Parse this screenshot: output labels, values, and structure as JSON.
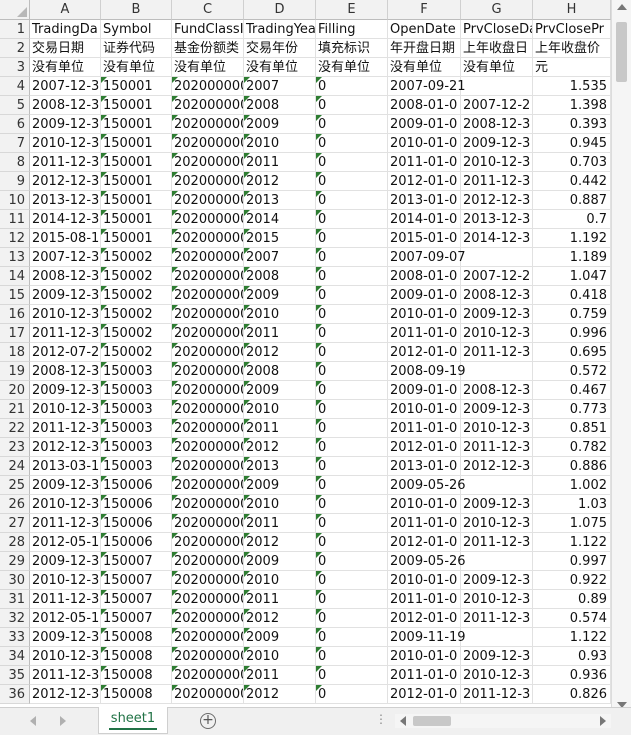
{
  "sheet_tab": "sheet1",
  "columns": [
    "A",
    "B",
    "C",
    "D",
    "E",
    "F",
    "G",
    "H"
  ],
  "row_numbers": [
    "1",
    "2",
    "3",
    "4",
    "5",
    "6",
    "7",
    "8",
    "9",
    "10",
    "11",
    "12",
    "13",
    "14",
    "15",
    "16",
    "17",
    "18",
    "19",
    "20",
    "21",
    "22",
    "23",
    "24",
    "25",
    "26",
    "27",
    "28",
    "29",
    "30",
    "31",
    "32",
    "33",
    "34",
    "35",
    "36"
  ],
  "rows": [
    [
      "TradingDa",
      "Symbol",
      "FundClassI",
      "TradingYea",
      "Filling",
      "OpenDate",
      "PrvCloseDa",
      "PrvClosePr"
    ],
    [
      "交易日期",
      "证券代码",
      "基金份额类",
      "交易年份",
      "填充标识",
      "年开盘日期",
      "上年收盘日",
      "上年收盘价"
    ],
    [
      "没有单位",
      "没有单位",
      "没有单位",
      "没有单位",
      "没有单位",
      "没有单位",
      "没有单位",
      "元"
    ],
    [
      "2007-12-3",
      "150001",
      "202000000",
      "2007",
      "0",
      "2007-09-21",
      "",
      "1.535"
    ],
    [
      "2008-12-3",
      "150001",
      "202000000",
      "2008",
      "0",
      "2008-01-0",
      "2007-12-2",
      "1.398"
    ],
    [
      "2009-12-3",
      "150001",
      "202000000",
      "2009",
      "0",
      "2009-01-0",
      "2008-12-3",
      "0.393"
    ],
    [
      "2010-12-3",
      "150001",
      "202000000",
      "2010",
      "0",
      "2010-01-0",
      "2009-12-3",
      "0.945"
    ],
    [
      "2011-12-3",
      "150001",
      "202000000",
      "2011",
      "0",
      "2011-01-0",
      "2010-12-3",
      "0.703"
    ],
    [
      "2012-12-3",
      "150001",
      "202000000",
      "2012",
      "0",
      "2012-01-0",
      "2011-12-3",
      "0.442"
    ],
    [
      "2013-12-3",
      "150001",
      "202000000",
      "2013",
      "0",
      "2013-01-0",
      "2012-12-3",
      "0.887"
    ],
    [
      "2014-12-3",
      "150001",
      "202000000",
      "2014",
      "0",
      "2014-01-0",
      "2013-12-3",
      "0.7"
    ],
    [
      "2015-08-1",
      "150001",
      "202000000",
      "2015",
      "0",
      "2015-01-0",
      "2014-12-3",
      "1.192"
    ],
    [
      "2007-12-3",
      "150002",
      "202000000",
      "2007",
      "0",
      "2007-09-07",
      "",
      "1.189"
    ],
    [
      "2008-12-3",
      "150002",
      "202000000",
      "2008",
      "0",
      "2008-01-0",
      "2007-12-2",
      "1.047"
    ],
    [
      "2009-12-3",
      "150002",
      "202000000",
      "2009",
      "0",
      "2009-01-0",
      "2008-12-3",
      "0.418"
    ],
    [
      "2010-12-3",
      "150002",
      "202000000",
      "2010",
      "0",
      "2010-01-0",
      "2009-12-3",
      "0.759"
    ],
    [
      "2011-12-3",
      "150002",
      "202000000",
      "2011",
      "0",
      "2011-01-0",
      "2010-12-3",
      "0.996"
    ],
    [
      "2012-07-2",
      "150002",
      "202000000",
      "2012",
      "0",
      "2012-01-0",
      "2011-12-3",
      "0.695"
    ],
    [
      "2008-12-3",
      "150003",
      "202000000",
      "2008",
      "0",
      "2008-09-19",
      "",
      "0.572"
    ],
    [
      "2009-12-3",
      "150003",
      "202000000",
      "2009",
      "0",
      "2009-01-0",
      "2008-12-3",
      "0.467"
    ],
    [
      "2010-12-3",
      "150003",
      "202000000",
      "2010",
      "0",
      "2010-01-0",
      "2009-12-3",
      "0.773"
    ],
    [
      "2011-12-3",
      "150003",
      "202000000",
      "2011",
      "0",
      "2011-01-0",
      "2010-12-3",
      "0.851"
    ],
    [
      "2012-12-3",
      "150003",
      "202000000",
      "2012",
      "0",
      "2012-01-0",
      "2011-12-3",
      "0.782"
    ],
    [
      "2013-03-1",
      "150003",
      "202000000",
      "2013",
      "0",
      "2013-01-0",
      "2012-12-3",
      "0.886"
    ],
    [
      "2009-12-3",
      "150006",
      "202000000",
      "2009",
      "0",
      "2009-05-26",
      "",
      "1.002"
    ],
    [
      "2010-12-3",
      "150006",
      "202000000",
      "2010",
      "0",
      "2010-01-0",
      "2009-12-3",
      "1.03"
    ],
    [
      "2011-12-3",
      "150006",
      "202000000",
      "2011",
      "0",
      "2011-01-0",
      "2010-12-3",
      "1.075"
    ],
    [
      "2012-05-1",
      "150006",
      "202000000",
      "2012",
      "0",
      "2012-01-0",
      "2011-12-3",
      "1.122"
    ],
    [
      "2009-12-3",
      "150007",
      "202000000",
      "2009",
      "0",
      "2009-05-26",
      "",
      "0.997"
    ],
    [
      "2010-12-3",
      "150007",
      "202000000",
      "2010",
      "0",
      "2010-01-0",
      "2009-12-3",
      "0.922"
    ],
    [
      "2011-12-3",
      "150007",
      "202000000",
      "2011",
      "0",
      "2011-01-0",
      "2010-12-3",
      "0.89"
    ],
    [
      "2012-05-1",
      "150007",
      "202000000",
      "2012",
      "0",
      "2012-01-0",
      "2011-12-3",
      "0.574"
    ],
    [
      "2009-12-3",
      "150008",
      "202000000",
      "2009",
      "0",
      "2009-11-19",
      "",
      "1.122"
    ],
    [
      "2010-12-3",
      "150008",
      "202000000",
      "2010",
      "0",
      "2010-01-0",
      "2009-12-3",
      "0.93"
    ],
    [
      "2011-12-3",
      "150008",
      "202000000",
      "2011",
      "0",
      "2011-01-0",
      "2010-12-3",
      "0.936"
    ],
    [
      "2012-12-3",
      "150008",
      "202000000",
      "2012",
      "0",
      "2012-01-0",
      "2011-12-3",
      "0.826"
    ]
  ]
}
